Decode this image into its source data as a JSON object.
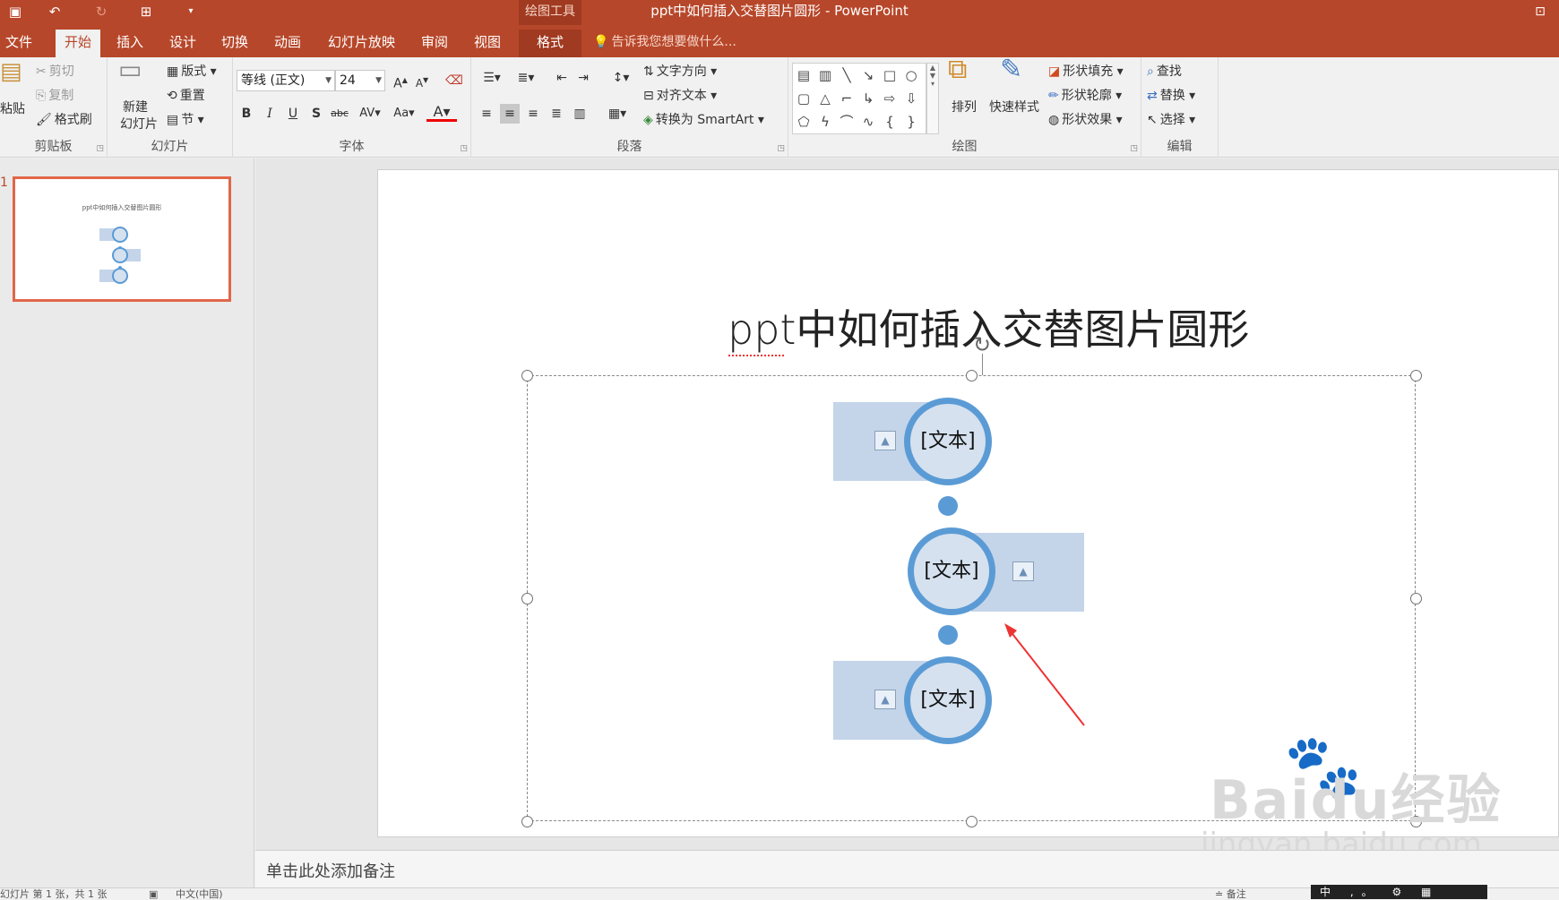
{
  "app": {
    "window_title": "ppt中如何插入交替图片圆形 - PowerPoint",
    "tool_group": "绘图工具",
    "qat": [
      "save-icon",
      "undo-icon",
      "redo-icon",
      "present-icon",
      "customize-icon"
    ]
  },
  "tabs": [
    {
      "label": "文件"
    },
    {
      "label": "开始",
      "active": true
    },
    {
      "label": "插入"
    },
    {
      "label": "设计"
    },
    {
      "label": "切换"
    },
    {
      "label": "动画"
    },
    {
      "label": "幻灯片放映"
    },
    {
      "label": "审阅"
    },
    {
      "label": "视图"
    },
    {
      "label": "格式"
    }
  ],
  "tell_me": "告诉我您想要做什么...",
  "ribbon": {
    "clipboard": {
      "label": "剪贴板",
      "paste": "粘贴",
      "cut": "剪切",
      "copy": "复制",
      "format_painter": "格式刷"
    },
    "slides": {
      "label": "幻灯片",
      "new_slide_1": "新建",
      "new_slide_2": "幻灯片",
      "layout": "版式",
      "reset": "重置",
      "section": "节"
    },
    "font": {
      "label": "字体",
      "font_name": "等线 (正文)",
      "font_size": "24"
    },
    "paragraph": {
      "label": "段落",
      "text_direction": "文字方向",
      "align_text": "对齐文本",
      "smartart": "转换为 SmartArt"
    },
    "drawing": {
      "label": "绘图",
      "arrange": "排列",
      "quick_styles": "快速样式",
      "shape_fill": "形状填充",
      "shape_outline": "形状轮廓",
      "shape_effects": "形状效果"
    },
    "editing": {
      "label": "编辑",
      "find": "查找",
      "replace": "替换",
      "select": "选择"
    }
  },
  "thumbnail": {
    "number": "1",
    "title": "ppt中如何插入交替图片圆形"
  },
  "slide": {
    "title": "ppt中如何插入交替图片圆形",
    "items": [
      {
        "text": "[文本]"
      },
      {
        "text": "[文本]"
      },
      {
        "text": "[文本]"
      }
    ]
  },
  "notes_placeholder": "单击此处添加备注",
  "status": {
    "left": "幻灯片 第 1 张，共 1 张",
    "lang": "中文(中国)",
    "notes": "备注",
    "ime": "中 ,。 "
  },
  "watermark": {
    "main": "Baidu经验",
    "sub": "jingyan.baidu.com"
  },
  "colors": {
    "accent": "#b7472a",
    "shape_blue": "#5b9bd5",
    "shape_fill": "#c4d4e9"
  }
}
